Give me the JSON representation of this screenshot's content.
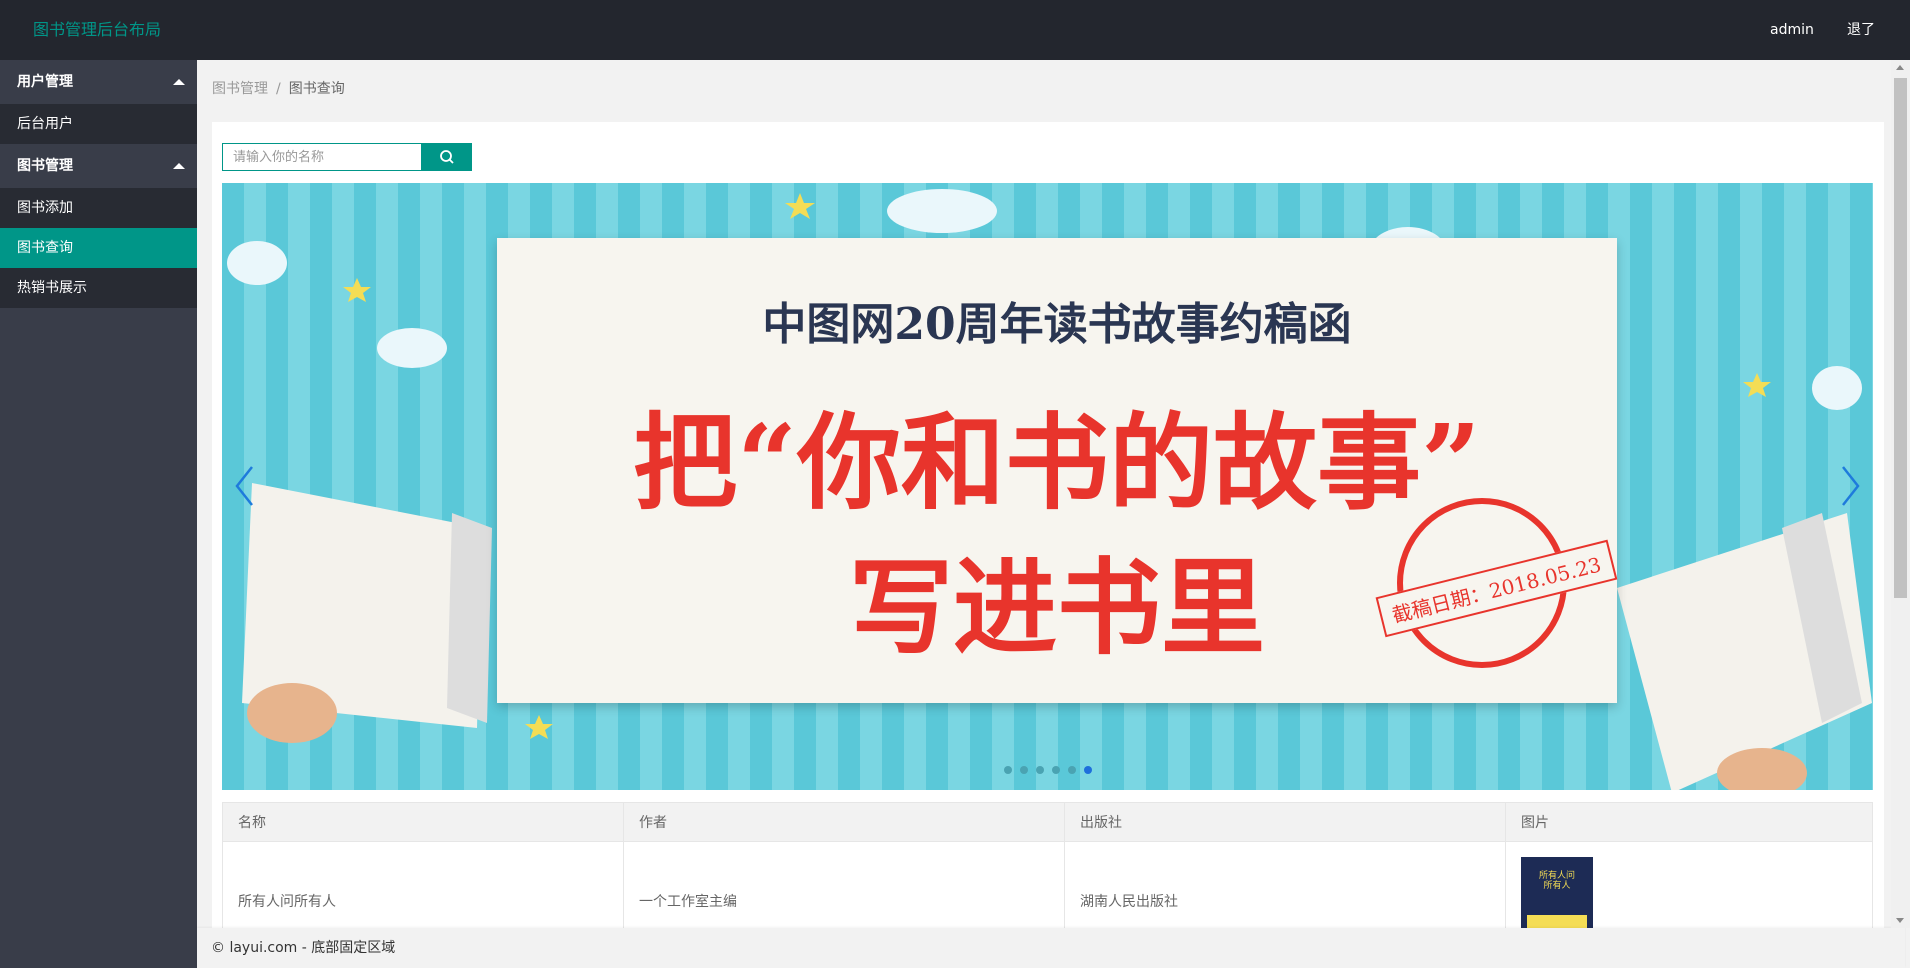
{
  "header": {
    "logo": "图书管理后台布局",
    "user": "admin",
    "logout": "退了"
  },
  "sidebar": {
    "groups": [
      {
        "label": "用户管理",
        "items": [
          {
            "label": "后台用户"
          }
        ]
      },
      {
        "label": "图书管理",
        "items": [
          {
            "label": "图书添加"
          },
          {
            "label": "图书查询",
            "active": true
          },
          {
            "label": "热销书展示"
          }
        ]
      }
    ]
  },
  "breadcrumb": {
    "parent": "图书管理",
    "separator": "/",
    "current": "图书查询"
  },
  "search": {
    "placeholder": "请输入你的名称"
  },
  "carousel": {
    "headline": "中图网20周年读书故事约稿函",
    "main_line1": "把“你和书的故事”",
    "main_line2": "写进书里",
    "stamp": "截稿日期：2018.05.23",
    "dots": 6,
    "active_dot": 6
  },
  "table": {
    "columns": [
      "名称",
      "作者",
      "出版社",
      "图片"
    ],
    "rows": [
      {
        "name": "所有人问所有人",
        "author": "一个工作室主编",
        "publisher": "湖南人民出版社",
        "image_text": "所有人问所有人"
      }
    ]
  },
  "footer": {
    "text": "© layui.com - 底部固定区域"
  },
  "colors": {
    "accent": "#009688",
    "header": "#23262e",
    "sidebar": "#393d49"
  }
}
